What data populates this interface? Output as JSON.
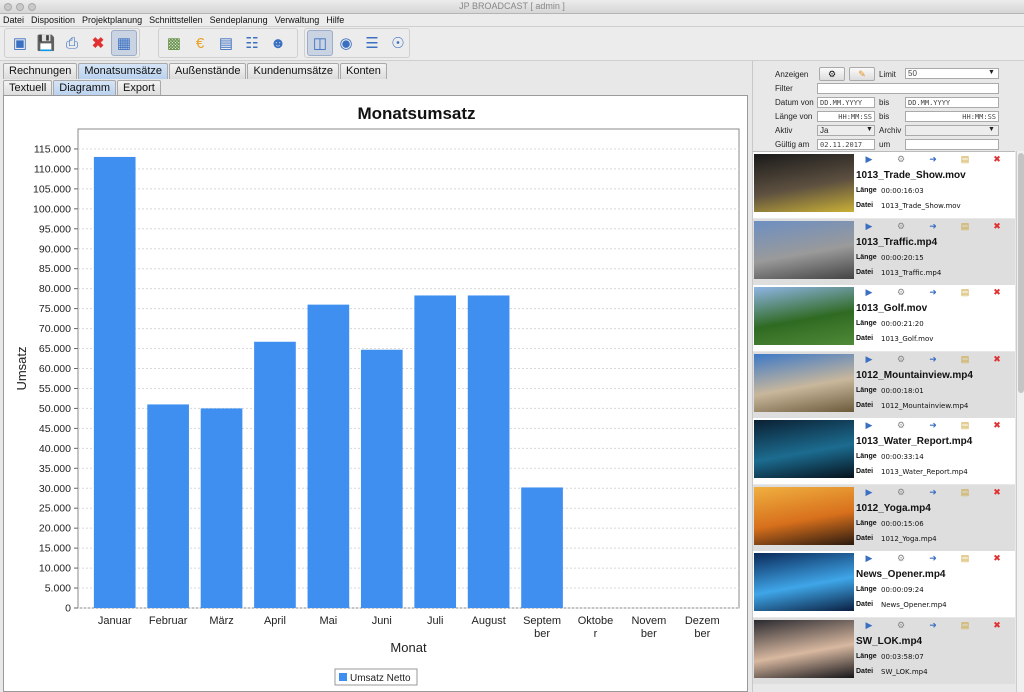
{
  "window": {
    "title": "JP BROADCAST [ admin ]"
  },
  "menu": [
    "Datei",
    "Disposition",
    "Projektplanung",
    "Schnittstellen",
    "Sendeplanung",
    "Verwaltung",
    "Hilfe"
  ],
  "toolbar": [
    "new-document-icon",
    "save-icon",
    "print-icon",
    "delete-icon",
    "calculator-icon",
    "tv-icon",
    "euro-icon",
    "chart-icon",
    "calendar-icon",
    "users-icon",
    "film-icon",
    "globe-icon",
    "list-icon",
    "compass-icon"
  ],
  "tabs_top": [
    "Rechnungen",
    "Monatsumsätze",
    "Außenstände",
    "Kundenumsätze",
    "Konten"
  ],
  "tabs_sub": [
    "Textuell",
    "Diagramm",
    "Export"
  ],
  "colors": {
    "bar": "#3f8ff0",
    "accent": "#3a6fc2",
    "delete": "#e03030"
  },
  "chart_data": {
    "type": "bar",
    "title": "Monatsumsatz",
    "xlabel": "Monat",
    "ylabel": "Umsatz",
    "ylim": [
      0,
      120000
    ],
    "yticks": [
      "0",
      "5.000",
      "10.000",
      "15.000",
      "20.000",
      "25.000",
      "30.000",
      "35.000",
      "40.000",
      "45.000",
      "50.000",
      "55.000",
      "60.000",
      "65.000",
      "70.000",
      "75.000",
      "80.000",
      "85.000",
      "90.000",
      "95.000",
      "100.000",
      "105.000",
      "110.000",
      "115.000"
    ],
    "categories": [
      [
        "Januar"
      ],
      [
        "Februar"
      ],
      [
        "März"
      ],
      [
        "April"
      ],
      [
        "Mai"
      ],
      [
        "Juni"
      ],
      [
        "Juli"
      ],
      [
        "August"
      ],
      [
        "Septem",
        "ber"
      ],
      [
        "Oktobe",
        "r"
      ],
      [
        "Novem",
        "ber"
      ],
      [
        "Dezem",
        "ber"
      ]
    ],
    "series": [
      {
        "name": "Umsatz Netto",
        "values": [
          113000,
          51000,
          50000,
          66700,
          76000,
          64700,
          78300,
          78300,
          30200,
          0,
          0,
          0
        ]
      }
    ],
    "grid": true,
    "legend": "bottom-center"
  },
  "filter": {
    "anzeigen_label": "Anzeigen",
    "limit_label": "Limit",
    "limit_value": "50",
    "filter_label": "Filter",
    "datum_von_label": "Datum von",
    "datum_von_placeholder": "DD.MM.YYYY",
    "bis_label": "bis",
    "datum_bis_placeholder": "DD.MM.YYYY",
    "laenge_von_label": "Länge von",
    "laenge_von_placeholder": "HH:MM:SS",
    "laenge_bis_placeholder": "HH:MM:SS",
    "aktiv_label": "Aktiv",
    "aktiv_value": "Ja",
    "archiv_label": "Archiv",
    "gueltig_label": "Gültig am",
    "gueltig_value": "02.11.2017",
    "um_label": "um"
  },
  "media_labels": {
    "laenge": "Länge",
    "datei": "Datei"
  },
  "media": [
    {
      "name": "1013_Trade_Show.mov",
      "length": "00:00:16:03",
      "file": "1013_Trade_Show.mov",
      "palette": [
        "#1a1a1a",
        "#5d5040",
        "#c9b037"
      ]
    },
    {
      "name": "1013_Traffic.mp4",
      "length": "00:00:20:15",
      "file": "1013_Traffic.mp4",
      "palette": [
        "#6d8fc2",
        "#9a9a9a",
        "#434343"
      ]
    },
    {
      "name": "1013_Golf.mov",
      "length": "00:00:21:20",
      "file": "1013_Golf.mov",
      "palette": [
        "#8fb5e6",
        "#2f6a22",
        "#4f8a38"
      ]
    },
    {
      "name": "1012_Mountainview.mp4",
      "length": "00:00:18:01",
      "file": "1012_Mountainview.mp4",
      "palette": [
        "#3d79c7",
        "#c9b79c",
        "#6b5a3a"
      ]
    },
    {
      "name": "1013_Water_Report.mp4",
      "length": "00:00:33:14",
      "file": "1013_Water_Report.mp4",
      "palette": [
        "#0b2033",
        "#1c6c90",
        "#06121c"
      ]
    },
    {
      "name": "1012_Yoga.mp4",
      "length": "00:00:15:06",
      "file": "1012_Yoga.mp4",
      "palette": [
        "#f0b040",
        "#d8701c",
        "#2a1a10"
      ]
    },
    {
      "name": "News_Opener.mp4",
      "length": "00:00:09:24",
      "file": "News_Opener.mp4",
      "palette": [
        "#0a2a5a",
        "#3fa6e8",
        "#0a1f40"
      ]
    },
    {
      "name": "SW_LOK.mp4",
      "length": "00:03:58:07",
      "file": "SW_LOK.mp4",
      "palette": [
        "#2a2a30",
        "#d8b8a0",
        "#15151a"
      ]
    }
  ]
}
